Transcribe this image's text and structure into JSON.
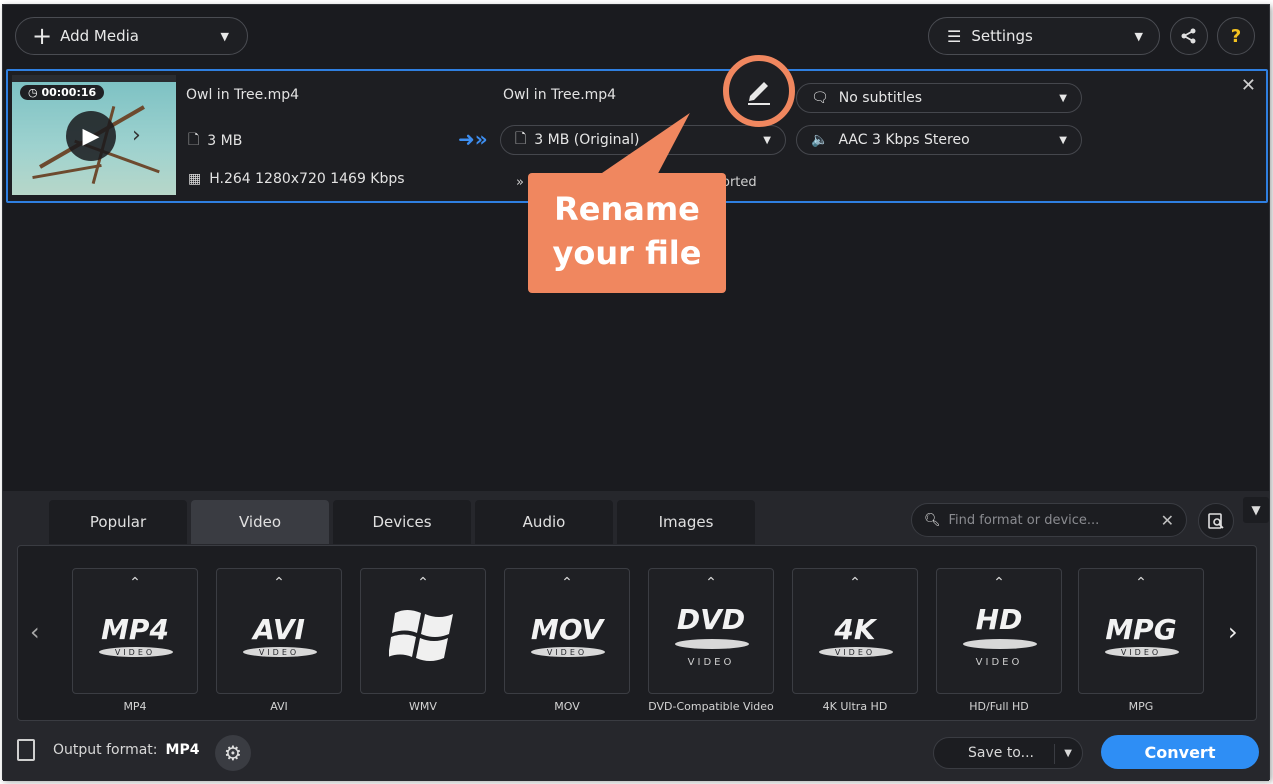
{
  "toolbar": {
    "add_media_label": "Add Media",
    "settings_label": "Settings",
    "help_label": "?"
  },
  "file": {
    "duration": "00:00:16",
    "source_name": "Owl in Tree.mp4",
    "source_size": "3 MB",
    "source_codec": "H.264 1280x720 1469 Kbps",
    "output_name": "Owl in Tree.mp4",
    "output_size": "3 MB (Original)",
    "subtitles": "No subtitles",
    "audio": "AAC 3 Kbps Stereo",
    "partial_status": "orted"
  },
  "callout": {
    "line1": "Rename",
    "line2": "your file"
  },
  "tabs": [
    {
      "label": "Popular"
    },
    {
      "label": "Video"
    },
    {
      "label": "Devices"
    },
    {
      "label": "Audio"
    },
    {
      "label": "Images"
    }
  ],
  "search": {
    "placeholder": "Find format or device..."
  },
  "formats": [
    {
      "logo": "MP4",
      "sub": "VIDEO",
      "label": "MP4"
    },
    {
      "logo": "AVI",
      "sub": "VIDEO",
      "label": "AVI"
    },
    {
      "logo": "",
      "sub": "",
      "label": "WMV"
    },
    {
      "logo": "MOV",
      "sub": "VIDEO",
      "label": "MOV"
    },
    {
      "logo": "DVD",
      "sub": "VIDEO",
      "label": "DVD-Compatible Video"
    },
    {
      "logo": "4K",
      "sub": "VIDEO",
      "label": "4K Ultra HD"
    },
    {
      "logo": "HD",
      "sub": "VIDEO",
      "label": "HD/Full HD"
    },
    {
      "logo": "MPG",
      "sub": "VIDEO",
      "label": "MPG"
    }
  ],
  "footer": {
    "output_format_label": "Output format:",
    "output_format_value": "MP4",
    "save_to_label": "Save to...",
    "convert_label": "Convert"
  },
  "colors": {
    "accent": "#2e8ef5",
    "selection_border": "#2f7fe0",
    "callout": "#f0875f",
    "background": "#1a1b1f"
  }
}
